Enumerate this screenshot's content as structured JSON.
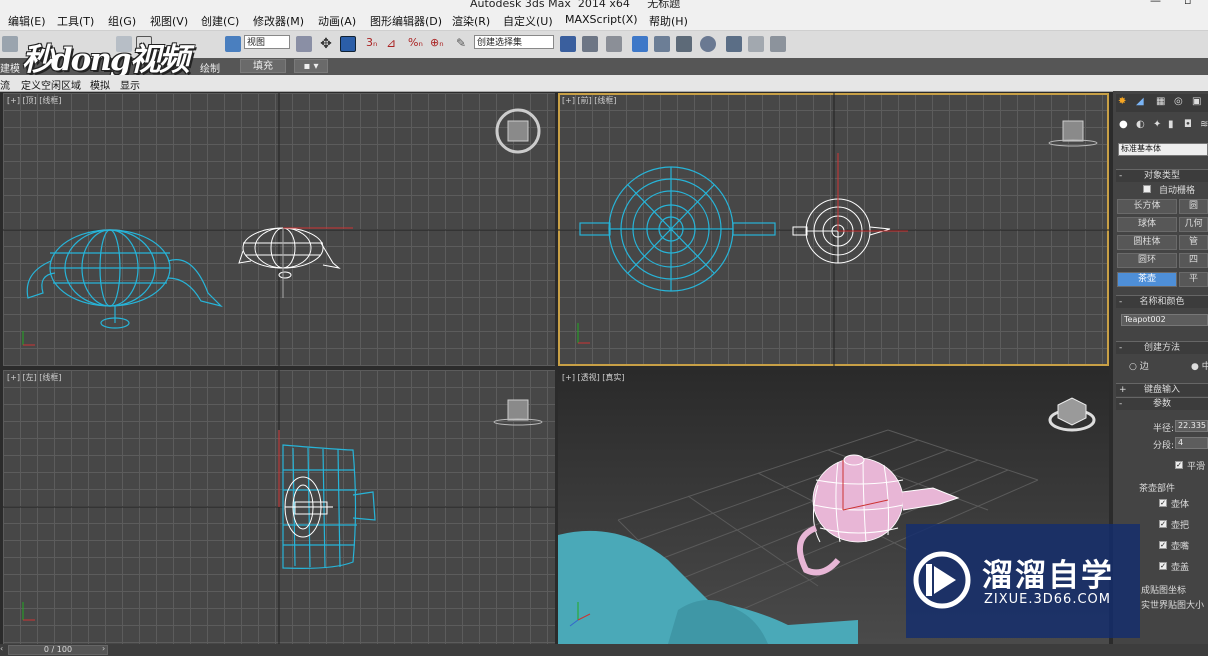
{
  "title_bar": {
    "title": "Autodesk 3ds Max  2014 x64     无标题"
  },
  "menu": [
    "编辑(E)",
    "工具(T)",
    "组(G)",
    "视图(V)",
    "创建(C)",
    "修改器(M)",
    "动画(A)",
    "图形编辑器(D)",
    "渲染(R)",
    "自定义(U)",
    "MAXScript(X)",
    "帮助(H)"
  ],
  "toolbar": {
    "view_dropdown": "视图",
    "selection_set_dropdown": "创建选择集",
    "logo_text": "秒dong视频"
  },
  "ribbon": {
    "tab_modeling": "建模",
    "tab_paint": "绘制",
    "fill_button": "填充"
  },
  "subbar": [
    "流",
    "定义空闲区域",
    "模拟",
    "显示"
  ],
  "viewports": {
    "top": "[+] [顶] [线框]",
    "front": "[+] [前] [线框]",
    "left": "[+] [左] [线框]",
    "perspective": "[+] [透视] [真实]"
  },
  "command_panel": {
    "category_dropdown": "标准基本体",
    "object_type_header": "对象类型",
    "auto_grid": "自动栅格",
    "buttons": [
      "长方体",
      "圆",
      "球体",
      "几何",
      "圆柱体",
      "管",
      "圆环",
      "四",
      "茶壶",
      "平"
    ],
    "selected_button": "茶壶",
    "name_color_header": "名称和颜色",
    "object_name": "Teapot002",
    "creation_method_header": "创建方法",
    "method_edge": "边",
    "method_center": "中",
    "keyboard_entry_header": "键盘输入",
    "params_header": "参数",
    "radius_label": "半径:",
    "radius_value": "22.335",
    "segments_label": "分段:",
    "segments_value": "4",
    "smooth_label": "平滑",
    "teapot_parts_label": "茶壶部件",
    "parts": [
      "壶体",
      "壶把",
      "壶嘴",
      "壶盖"
    ],
    "gen_map_coords": "成贴图坐标",
    "real_world_map": "实世界贴图大小"
  },
  "timeline": {
    "frame": "0 / 100"
  },
  "watermark": {
    "brand": "溜溜自学",
    "url": "ZIXUE.3D66.COM"
  },
  "colors": {
    "accent": "#4e8fd8",
    "active_border": "#c8a046",
    "wire_cyan": "#27b4d8",
    "teapot_pink": "#e8b6d6"
  }
}
